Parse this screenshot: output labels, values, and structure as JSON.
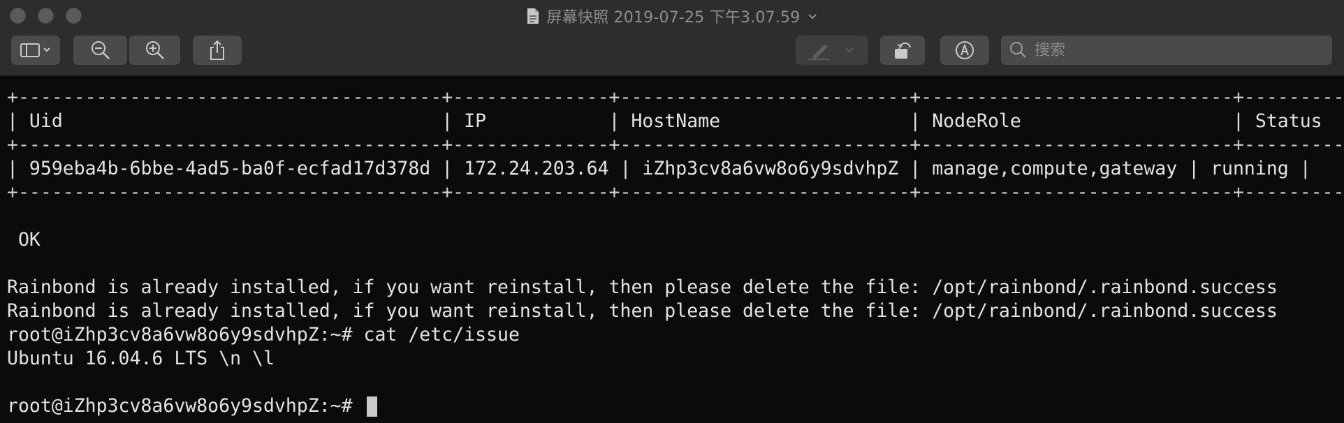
{
  "window": {
    "title": "屏幕快照 2019-07-25 下午3.07.59"
  },
  "toolbar": {
    "sidebar_icon": "sidebar-icon",
    "zoom_out_icon": "zoom-out-icon",
    "zoom_in_icon": "zoom-in-icon",
    "share_icon": "share-icon",
    "markup_icon": "pen-icon",
    "rotate_icon": "rotate-icon",
    "annotate_icon": "markup-icon",
    "search": {
      "placeholder": "搜索",
      "value": ""
    }
  },
  "terminal": {
    "table": {
      "border": "+--------------------------------------+--------------+--------------------------+----------------------------+---------+",
      "header": "| Uid                                  | IP           | HostName                 | NodeRole                   | Status  |",
      "columns": [
        "Uid",
        "IP",
        "HostName",
        "NodeRole",
        "Status"
      ],
      "row": "| 959eba4b-6bbe-4ad5-ba0f-ecfad17d378d | 172.24.203.64 | iZhp3cv8a6vw8o6y9sdvhpZ | manage,compute,gateway | running |",
      "row_cells": [
        "959eba4b-6bbe-4ad5-ba0f-ecfad17d378d",
        "172.24.203.64",
        "iZhp3cv8a6vw8o6y9sdvhpZ",
        "manage,compute,gateway",
        "running"
      ]
    },
    "ok_line": " OK",
    "message_1": "Rainbond is already installed, if you want reinstall, then please delete the file: /opt/rainbond/.rainbond.success",
    "message_2": "Rainbond is already installed, if you want reinstall, then please delete the file: /opt/rainbond/.rainbond.success",
    "command_line": "root@iZhp3cv8a6vw8o6y9sdvhpZ:~# cat /etc/issue",
    "issue_output": "Ubuntu 16.04.6 LTS \\n \\l",
    "prompt": "root@iZhp3cv8a6vw8o6y9sdvhpZ:~# "
  }
}
